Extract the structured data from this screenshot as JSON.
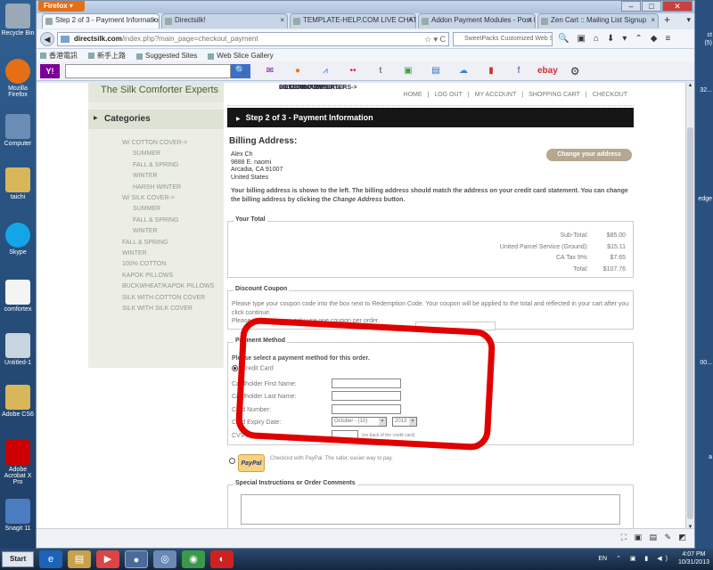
{
  "browser": {
    "menu_label": "Firefox",
    "tabs": [
      {
        "label": "Step 2 of 3 - Payment Information : ...",
        "active": true
      },
      {
        "label": "Directsilk!",
        "active": false
      },
      {
        "label": "TEMPLATE-HELP.COM LIVE CHAT",
        "active": false
      },
      {
        "label": "Addon Payment Modules - Post New ...",
        "active": false
      },
      {
        "label": "Zen Cart :: Mailing List Signup",
        "active": false
      }
    ],
    "url_domain": "directsilk.com",
    "url_path": "/index.php?main_page=checkout_payment",
    "search_placeholder": "SweetPacks Customized Web S",
    "bookmarks": [
      "香港電訊",
      "新手上路",
      "Suggested Sites",
      "Web Slice Gallery"
    ],
    "toolbar_ebay": "ebay"
  },
  "desktop": {
    "icons": [
      "Recycle Bin",
      "Mozilla Firefox",
      "Computer",
      "taichi",
      "Skype",
      "comfortex",
      "Untitled-1",
      "Adobe CS6",
      "Adobe Acrobat X Pro",
      "Snagit 11"
    ],
    "right_labels": [
      "ct",
      "(5)",
      "32...",
      "edge",
      "00...",
      "a"
    ]
  },
  "site": {
    "brand": "The Silk Comforter Experts",
    "categories_title": "Categories",
    "categories": [
      {
        "label": "SILK COMFORTERS->",
        "level": 0
      },
      {
        "label": "W/ COTTON COVER->",
        "level": 1
      },
      {
        "label": "SUMMER",
        "level": 2
      },
      {
        "label": "FALL & SPRING",
        "level": 2
      },
      {
        "label": "WINTER",
        "level": 2
      },
      {
        "label": "HARSH WINTER",
        "level": 2
      },
      {
        "label": "W/ SILK COVER->",
        "level": 1
      },
      {
        "label": "SUMMER",
        "level": 2
      },
      {
        "label": "FALL & SPRING",
        "level": 2
      },
      {
        "label": "WINTER",
        "level": 2
      },
      {
        "label": "COTTON COMFORTERS->",
        "level": 0
      },
      {
        "label": "FALL & SPRING",
        "level": 1
      },
      {
        "label": "WINTER",
        "level": 1
      },
      {
        "label": "DUVET COVERS->",
        "level": 0
      },
      {
        "label": "100% COTTON",
        "level": 1
      },
      {
        "label": "PILLOWS->",
        "level": 0
      },
      {
        "label": "KAPOK PILLOWS",
        "level": 1
      },
      {
        "label": "BUCKWHEAT/KAPOK PILLOWS",
        "level": 1
      },
      {
        "label": "SILK WITH COTTON COVER",
        "level": 1
      },
      {
        "label": "SILK WITH SILK COVER",
        "level": 1
      }
    ],
    "top_links": [
      "HOME",
      "LOG OUT",
      "MY ACCOUNT",
      "SHOPPING CART",
      "CHECKOUT"
    ],
    "step_title": "Step 2 of 3 - Payment Information",
    "billing_title": "Billing Address:",
    "address": [
      "Alex Ch",
      "9888 E. naomi",
      "Arcadia, CA 91007",
      "United States"
    ],
    "change_address_label": "Change your address",
    "billing_note_1": "Your billing address is shown to the left. The billing address should match the address on your credit card statement. You can change the billing address by clicking the ",
    "billing_note_em": "Change Address",
    "billing_note_2": " button.",
    "your_total_title": "Your Total",
    "totals": [
      {
        "label": "Sub-Total:",
        "value": "$85.00"
      },
      {
        "label": "United Parcel Service (Ground):",
        "value": "$15.11"
      },
      {
        "label": "CA Tax 9%:",
        "value": "$7.65"
      },
      {
        "label": "Total:",
        "value": "$107.76"
      }
    ],
    "discount_title": "Discount Coupon",
    "discount_text": "Please type your coupon code into the box next to Redemption Code. Your coupon will be applied to the total and reflected in your cart after you click continue.",
    "discount_note": "Please note: you may only use one coupon per order.",
    "payment_title": "Payment Method",
    "payment_prompt": "Please select a payment method for this order.",
    "credit_card_label": "Credit Card",
    "fields": {
      "first_name": "Cardholder First Name:",
      "last_name": "Cardholder Last Name:",
      "card_number": "Card Number:",
      "expiry": "Card Expiry Date:",
      "cvv": "CVV Number:"
    },
    "expiry_month": "October - (10)",
    "expiry_year": "2013",
    "cvv_note": "(on back of the credit card)",
    "paypal_logo": "PayPal",
    "paypal_text": "Checkout with PayPal. The safer, easier way to pay.",
    "comments_title": "Special Instructions or Order Comments"
  },
  "taskbar": {
    "start_label": "Start",
    "lang": "EN",
    "time": "4:07 PM",
    "date": "10/31/2013"
  },
  "colors": {
    "annotation_red": "#e10000",
    "step_bar": "#161616",
    "change_button": "#b4a890",
    "sidebar_bg": "#eceee6"
  }
}
